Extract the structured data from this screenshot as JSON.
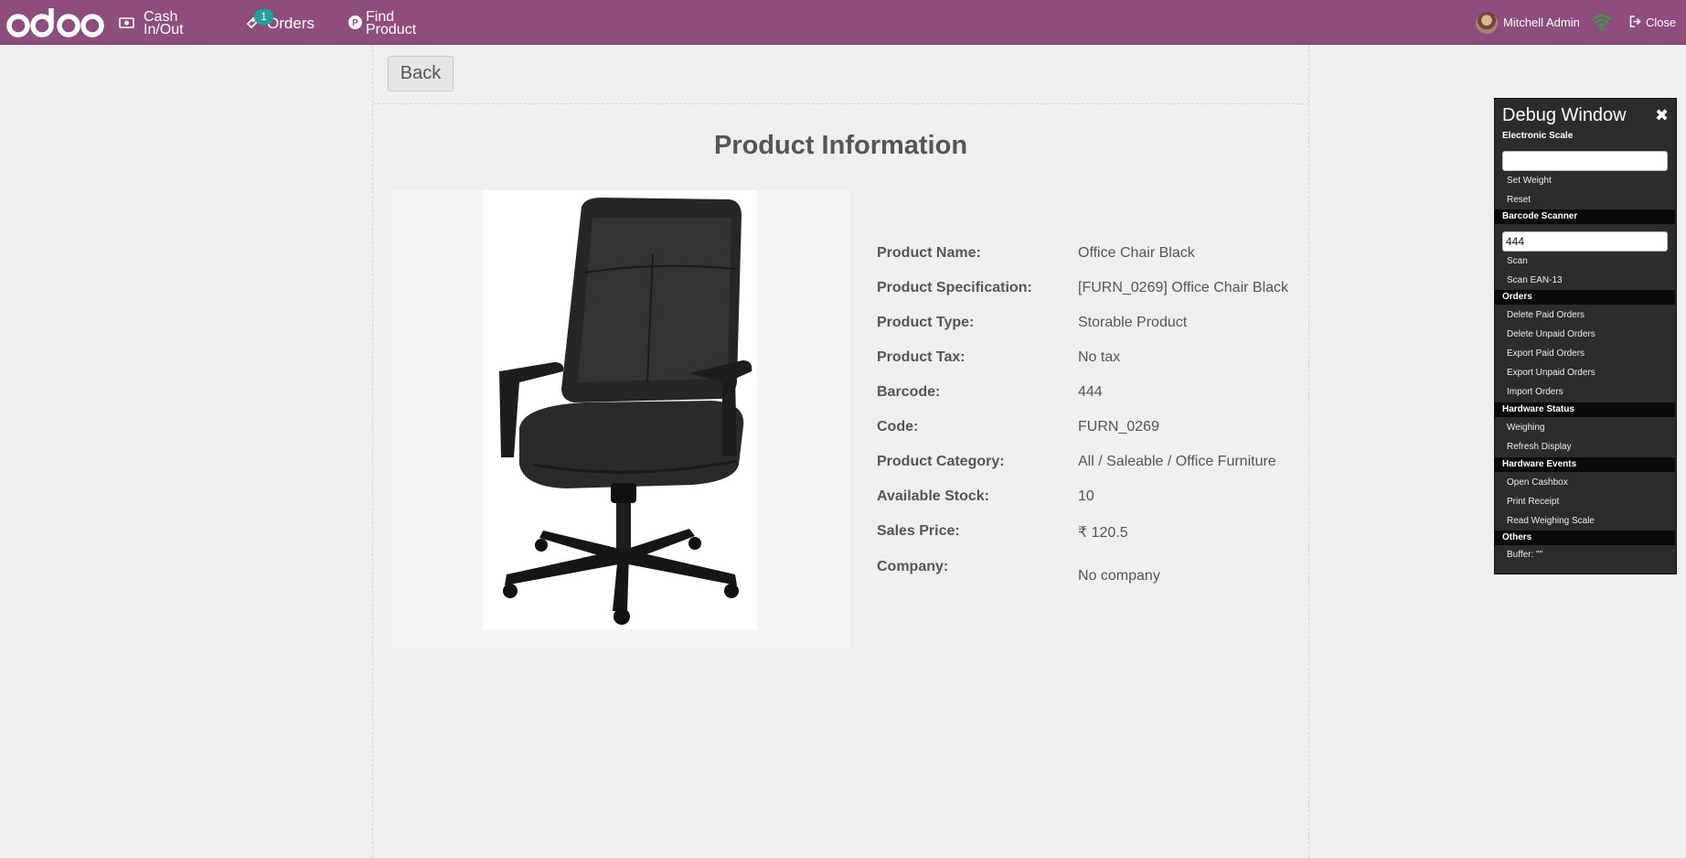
{
  "navbar": {
    "logo_text": "odoo",
    "cash_label_line1": "Cash",
    "cash_label_line2": "In/Out",
    "orders_label": "Orders",
    "orders_badge": "1",
    "find_label_line1": "Find",
    "find_label_line2": "Product",
    "user_name": "Mitchell Admin",
    "close_label": "Close",
    "wifi_color": "#28a745"
  },
  "screen": {
    "back_label": "Back",
    "title": "Product Information"
  },
  "product": {
    "fields": [
      {
        "label": "Product Name:",
        "value": "Office Chair Black"
      },
      {
        "label": "Product Specification:",
        "value": "[FURN_0269] Office Chair Black"
      },
      {
        "label": "Product Type:",
        "value": "Storable Product"
      },
      {
        "label": "Product Tax:",
        "value": "No tax"
      },
      {
        "label": "Barcode:",
        "value": "444"
      },
      {
        "label": "Code:",
        "value": "FURN_0269"
      },
      {
        "label": "Product Category:",
        "value": "All / Saleable / Office Furniture"
      },
      {
        "label": "Available Stock:",
        "value": "10"
      },
      {
        "label": "Sales Price:",
        "value": "₹ 120.5"
      },
      {
        "label": "Company:",
        "value": "No company"
      }
    ]
  },
  "debug": {
    "title": "Debug Window",
    "close_glyph": "✖",
    "scale_section": "Electronic Scale",
    "weight_value": "",
    "set_weight": "Set Weight",
    "reset": "Reset",
    "barcode_section": "Barcode Scanner",
    "barcode_value": "444",
    "scan": "Scan",
    "scan_ean": "Scan EAN-13",
    "orders_section": "Orders",
    "delete_paid": "Delete Paid Orders",
    "delete_unpaid": "Delete Unpaid Orders",
    "export_paid": "Export Paid Orders",
    "export_unpaid": "Export Unpaid Orders",
    "import_orders": "Import Orders",
    "hw_status_section": "Hardware Status",
    "weighing": "Weighing",
    "refresh_display": "Refresh Display",
    "hw_events_section": "Hardware Events",
    "open_cashbox": "Open Cashbox",
    "print_receipt": "Print Receipt",
    "read_scale": "Read Weighing Scale",
    "others_section": "Others",
    "buffer": "Buffer: \"\""
  }
}
